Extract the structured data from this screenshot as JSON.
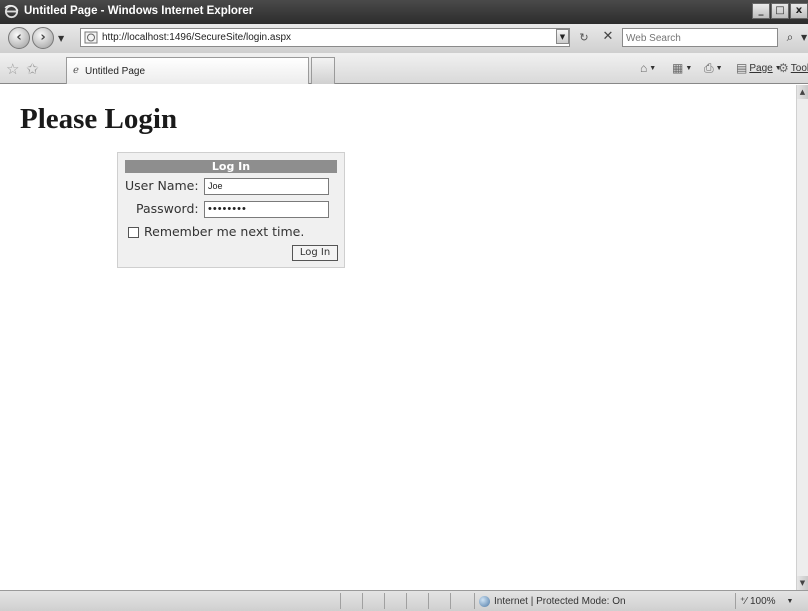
{
  "window": {
    "title": "Untitled Page - Windows Internet Explorer",
    "controls": {
      "minimize": "_",
      "maximize": "□",
      "close": "x"
    }
  },
  "address_bar": {
    "url": "http://localhost:1496/SecureSite/login.aspx",
    "search_placeholder": "Web Search"
  },
  "tabs": [
    {
      "label": "Untitled Page",
      "icon": "ie-page-icon"
    }
  ],
  "command_bar": {
    "page_label": "Page",
    "tools_label": "Tools"
  },
  "page": {
    "heading": "Please Login",
    "login": {
      "header": "Log In",
      "username_label": "User Name:",
      "username_value": "Joe",
      "password_label": "Password:",
      "password_value": "••••••••",
      "remember_label": "Remember me next time.",
      "remember_checked": false,
      "submit_label": "Log In"
    }
  },
  "status_bar": {
    "zone": "Internet | Protected Mode: On",
    "zoom": "100%"
  }
}
